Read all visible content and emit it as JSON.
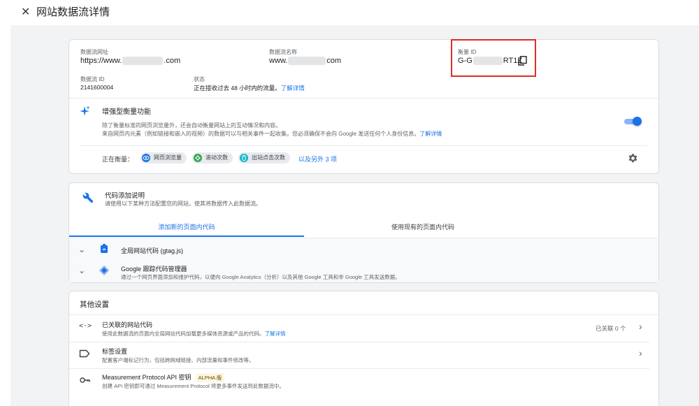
{
  "header": {
    "close_icon": "close-icon",
    "title": "网站数据流详情"
  },
  "stream": {
    "url_label": "数据流网址",
    "url_prefix": "https://www.",
    "url_suffix": ".com",
    "name_label": "数据流名称",
    "name_prefix": "www.",
    "name_suffix": "com",
    "measurement_label": "衡量 ID",
    "measurement_prefix": "G-G",
    "measurement_suffix": "RT1Z",
    "stream_id_label": "数据流 ID",
    "stream_id_value": "2141600004",
    "status_label": "状态",
    "status_value": "正在接收过去 48 小时内的流量。",
    "status_link": "了解详情"
  },
  "enhanced": {
    "title": "增强型衡量功能",
    "desc1": "除了衡量标准的网页浏览量外，还会自动衡量网站上的互动情况和内容。",
    "desc2": "来自网页内元素（例如链接和嵌入的视频）的数据可以与相关事件一起收集。您必须确保不会向 Google 发送任何个人身份信息。",
    "desc_link": "了解详情",
    "toggle_on": true,
    "measuring_label": "正在衡量：",
    "chips": [
      "网页浏览量",
      "滚动次数",
      "出站点击次数"
    ],
    "more_link": "以及另外 3 项"
  },
  "tagging": {
    "title": "代码添加说明",
    "desc": "请使用以下某种方法配置您的网站，使其将数据传入此数据流。",
    "tabs": [
      "添加新的页面内代码",
      "使用现有的页面内代码"
    ],
    "items": [
      {
        "title": "全局网站代码 (gtag.js)",
        "desc": ""
      },
      {
        "title": "Google 跟踪代码管理器",
        "desc": "通过一个网页界面添加和维护代码，以便向 Google Analytics（分析）以及其他 Google 工具和非 Google 工具发送数据。"
      }
    ]
  },
  "other": {
    "title": "其他设置",
    "rows": [
      {
        "icon": "code-icon",
        "title": "已关联的网站代码",
        "desc": "使用此数据流的页面内全局网站代码加载更多媒体资源或产品的代码。",
        "link": "了解详情",
        "meta": "已关联 0 个"
      },
      {
        "icon": "label-icon",
        "title": "标签设置",
        "desc": "配置客户端标记行为，包括跨网域链接、内部流量和事件修改等。",
        "link": "",
        "meta": ""
      },
      {
        "icon": "key-icon",
        "title": "Measurement Protocol API 密钥",
        "badge": "ALPHA 版",
        "desc": "创建 API 密钥即可通过 Measurement Protocol 将更多事件发送到此数据流中。",
        "link": "",
        "meta": ""
      }
    ]
  },
  "colors": {
    "accent": "#1a73e8",
    "highlight_box": "#d93025"
  }
}
